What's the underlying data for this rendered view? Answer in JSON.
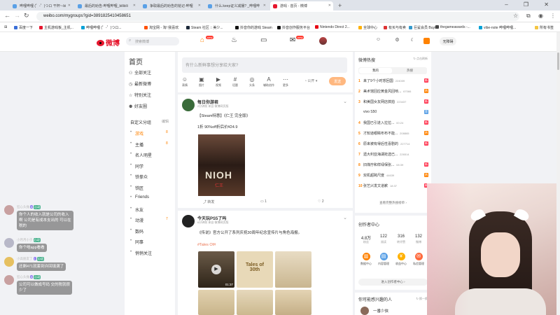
{
  "browser": {
    "tabs": [
      {
        "title": "哔哩哔哩 (゜-゜)つロ 干杯~-bi"
      },
      {
        "title": "最后的劝告-哔哩哔哩_bilibili"
      },
      {
        "title": "争取最后的劝告的铭记-哔哩"
      },
      {
        "title": "什么.keep证义减播? _哔哩哔"
      },
      {
        "title": "游戏 - 首页 - 微博"
      }
    ],
    "active_tab_index": 4,
    "url": "weibo.com/mygroups?gid=3891825410458651",
    "bookmarks": [
      "百度一下",
      "主机游戏板_主机...",
      "哔哩哔哩 (゜-゜)つロ...",
      "淘宝网 - 淘! 我喜欢",
      "Steam 社区 :: 美少...",
      "抖音你的游戏 Steam",
      "抖音创作服务平台",
      "Nintendo Direct 2...",
      "全球中心",
      "有买与有卖",
      "巨鲨会员 Buyin",
      "thegameawards -...",
      "vibe-note 哔哩哔哩...",
      "所有书签"
    ]
  },
  "weibo": {
    "logo_text": "微博",
    "search_placeholder": "搜索微博",
    "login_btn": "无障碍",
    "nav_badge_home": "new",
    "nav_badge_msg": "new",
    "left_nav": {
      "title": "首页",
      "items": [
        "全部关注",
        "最新微博",
        "特别关注",
        "好友圈"
      ],
      "custom_title": "自定义分组",
      "custom_edit": "编辑",
      "groups": [
        {
          "label": "游戏",
          "count": "8"
        },
        {
          "label": "主播",
          "count": "8"
        },
        {
          "label": "名人明星",
          "count": ""
        },
        {
          "label": "同学",
          "count": ""
        },
        {
          "label": "铁拳众",
          "count": ""
        },
        {
          "label": "铁匠",
          "count": ""
        },
        {
          "label": "Friends",
          "count": ""
        },
        {
          "label": "水友",
          "count": ""
        },
        {
          "label": "动漫",
          "count": "7"
        },
        {
          "label": "数码",
          "count": ""
        },
        {
          "label": "同事",
          "count": ""
        },
        {
          "label": "悄悄关注",
          "count": ""
        }
      ]
    },
    "composer": {
      "placeholder": "有什么新鲜事想分享给大家?",
      "tools": [
        "表情",
        "图片",
        "视频",
        "话题",
        "头条",
        "辅助创作",
        "更多"
      ],
      "visibility": "公开",
      "send": "发送"
    },
    "posts": [
      {
        "author": "每日你游君",
        "meta": "2分钟前  来自 微博网页版",
        "lines": [
          "【Steam特惠】《仁王 完全版》",
          "1折 90%off折后价¥24.9"
        ],
        "image_text": "NIOH",
        "image_sub": "仁王",
        "actions": {
          "share": "转发",
          "comment": "1",
          "like": "2"
        }
      },
      {
        "author": "今天玩PS5了吗",
        "meta": "6分钟前  来自 微博网页版",
        "lines": [
          "《传说》官方公开了系列庆祝30周年纪念宣传片与角色海报。"
        ],
        "tag": "#Tales Of#",
        "video_duration": "01:37",
        "tile_text": "Tales of 30th"
      }
    ],
    "hot_search": {
      "title": "微博热搜",
      "refresh": "点击刷新",
      "tabs": [
        "我的",
        "热搜"
      ],
      "items": [
        {
          "rank": "1",
          "text": "来了9个小时想回国",
          "count": "224009",
          "badge": "新"
        },
        {
          "rank": "2",
          "text": "美术馆回应黄金风回唢...",
          "count": "67066",
          "badge": "热"
        },
        {
          "rank": "3",
          "text": "和美国女友网店搞拍",
          "count": "223437",
          "badge": "新"
        },
        {
          "rank": "",
          "text": "vivo S50",
          "count": "",
          "badge": "荐"
        },
        {
          "rank": "4",
          "text": "我国已引进入拉拉...",
          "count": "00:24",
          "badge": "新"
        },
        {
          "rank": "5",
          "text": "才知道眼睛布布不能...",
          "count": "208865",
          "badge": "热"
        },
        {
          "rank": "6",
          "text": "原来被有得后性喜剧的",
          "count": "227714",
          "badge": "新"
        },
        {
          "rank": "7",
          "text": "遗大利亚海湖抢选已...",
          "count": "226514",
          "badge": ""
        },
        {
          "rank": "8",
          "text": "旧煤疗和样绿保张...",
          "count": "08:39",
          "badge": "新"
        },
        {
          "rank": "9",
          "text": "双机超跨尺度",
          "count": "44639",
          "badge": "热"
        },
        {
          "rank": "10",
          "text": "张艺兴发文道歉",
          "count": "18:37",
          "badge": "新"
        }
      ],
      "more": "查看完整热搜榜单"
    },
    "creator": {
      "title": "创作者中心",
      "stats": [
        {
          "num": "4.8万",
          "label": "粉丝"
        },
        {
          "num": "122",
          "label": "阅读"
        },
        {
          "num": "316",
          "label": "转评赞"
        },
        {
          "num": "132",
          "label": "微博"
        }
      ],
      "icons": [
        {
          "label": "数据中心",
          "color": "#ff8200"
        },
        {
          "label": "内容管理",
          "color": "#5aa0e6"
        },
        {
          "label": "收益中心",
          "color": "#ffb100"
        },
        {
          "label": "私信管理",
          "color": "#ff6a3d"
        }
      ],
      "more": "进入创作者中心"
    },
    "may_know": {
      "title": "你可能感兴趣的人",
      "change": "换一换",
      "person": "一番少侠"
    }
  },
  "live_chat": [
    {
      "name": "狂心头抛",
      "badges": [
        "8",
        "心动"
      ],
      "text": [
        "你个人的收入就是公司的收入",
        "啊 公司是有成本支出的 可以在",
        "税的"
      ],
      "avatar": "#c8a0a0"
    },
    {
      "name": "小月月小于",
      "badges": [
        "心动"
      ],
      "text": [
        "你个啥app看看"
      ],
      "avatar": "#b8b8c8"
    },
    {
      "name": "小高朋友了",
      "badges": [
        "1",
        "心动"
      ],
      "text": [
        "还剩471就套到许回填满了"
      ],
      "avatar": "#e6c060"
    },
    {
      "name": "狂心头抛",
      "badges": [
        "8",
        "心动"
      ],
      "text": [
        "公司可以做成号码 交的税就很",
        "少了"
      ],
      "avatar": "#c8a0a0"
    }
  ],
  "colors": {
    "accent": "#ff8200",
    "brand": "#e6162d",
    "tag": "#eb7350"
  }
}
